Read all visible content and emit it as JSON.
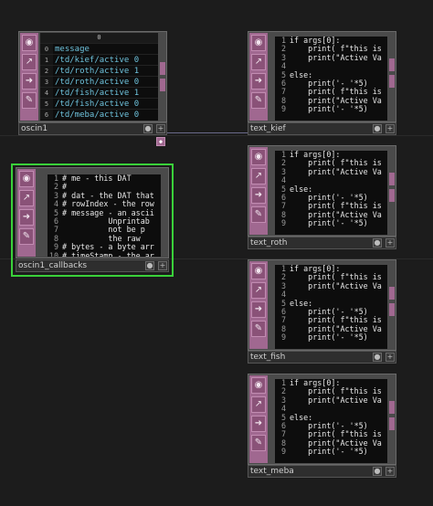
{
  "nodes": {
    "oscin1": {
      "name": "oscin1",
      "column_header": "0",
      "rows": [
        {
          "index": "0",
          "value": "message"
        },
        {
          "index": "1",
          "value": "/td/kief/active 0"
        },
        {
          "index": "2",
          "value": "/td/roth/active 1"
        },
        {
          "index": "3",
          "value": "/td/roth/active 0"
        },
        {
          "index": "4",
          "value": "/td/fish/active 1"
        },
        {
          "index": "5",
          "value": "/td/fish/active 0"
        },
        {
          "index": "6",
          "value": "/td/meba/active 0"
        }
      ]
    },
    "oscin1_callbacks": {
      "name": "oscin1_callbacks",
      "lines": [
        {
          "n": "1",
          "t": "# me - this DAT"
        },
        {
          "n": "2",
          "t": "#"
        },
        {
          "n": "3",
          "t": "# dat - the DAT that"
        },
        {
          "n": "4",
          "t": "# rowIndex - the row"
        },
        {
          "n": "5",
          "t": "# message - an ascii"
        },
        {
          "n": "6",
          "t": "          Unprintab"
        },
        {
          "n": "7",
          "t": "          not be p"
        },
        {
          "n": "8",
          "t": "          the raw "
        },
        {
          "n": "9",
          "t": "# bytes - a byte arr"
        },
        {
          "n": "10",
          "t": "# timeStamp - the ar"
        }
      ]
    },
    "text_kief": {
      "name": "text_kief",
      "lines": [
        {
          "n": "1",
          "t": "if args[0]:"
        },
        {
          "n": "2",
          "t": "    print( f\"this is"
        },
        {
          "n": "3",
          "t": "    print(\"Active Va"
        },
        {
          "n": "4",
          "t": ""
        },
        {
          "n": "5",
          "t": "else:"
        },
        {
          "n": "6",
          "t": "    print('- '*5)"
        },
        {
          "n": "7",
          "t": "    print( f\"this is"
        },
        {
          "n": "8",
          "t": "    print(\"Active Va"
        },
        {
          "n": "9",
          "t": "    print('- '*5)"
        }
      ]
    },
    "text_roth": {
      "name": "text_roth",
      "lines": [
        {
          "n": "1",
          "t": "if args[0]:"
        },
        {
          "n": "2",
          "t": "    print( f\"this is"
        },
        {
          "n": "3",
          "t": "    print(\"Active Va"
        },
        {
          "n": "4",
          "t": ""
        },
        {
          "n": "5",
          "t": "else:"
        },
        {
          "n": "6",
          "t": "    print('- '*5)"
        },
        {
          "n": "7",
          "t": "    print( f\"this is"
        },
        {
          "n": "8",
          "t": "    print(\"Active Va"
        },
        {
          "n": "9",
          "t": "    print('- '*5)"
        }
      ]
    },
    "text_fish": {
      "name": "text_fish",
      "lines": [
        {
          "n": "1",
          "t": "if args[0]:"
        },
        {
          "n": "2",
          "t": "    print( f\"this is"
        },
        {
          "n": "3",
          "t": "    print(\"Active Va"
        },
        {
          "n": "4",
          "t": ""
        },
        {
          "n": "5",
          "t": "else:"
        },
        {
          "n": "6",
          "t": "    print('- '*5)"
        },
        {
          "n": "7",
          "t": "    print( f\"this is"
        },
        {
          "n": "8",
          "t": "    print(\"Active Va"
        },
        {
          "n": "9",
          "t": "    print('- '*5)"
        }
      ]
    },
    "text_meba": {
      "name": "text_meba",
      "lines": [
        {
          "n": "1",
          "t": "if args[0]:"
        },
        {
          "n": "2",
          "t": "    print( f\"this is"
        },
        {
          "n": "3",
          "t": "    print(\"Active Va"
        },
        {
          "n": "4",
          "t": ""
        },
        {
          "n": "5",
          "t": "else:"
        },
        {
          "n": "6",
          "t": "    print('- '*5)"
        },
        {
          "n": "7",
          "t": "    print( f\"this is"
        },
        {
          "n": "8",
          "t": "    print(\"Active Va"
        },
        {
          "n": "9",
          "t": "    print('- '*5)"
        }
      ]
    }
  },
  "sidebar_icons": [
    "viewer-active-icon",
    "cook-icon",
    "bypass-arrow-icon",
    "python-icon"
  ],
  "colors": {
    "background": "#1c1c1c",
    "operator_pink": "#a06890",
    "selection_green": "#3ad13a",
    "table_text": "#6ec2dc",
    "code_text": "#e8e8e8"
  }
}
